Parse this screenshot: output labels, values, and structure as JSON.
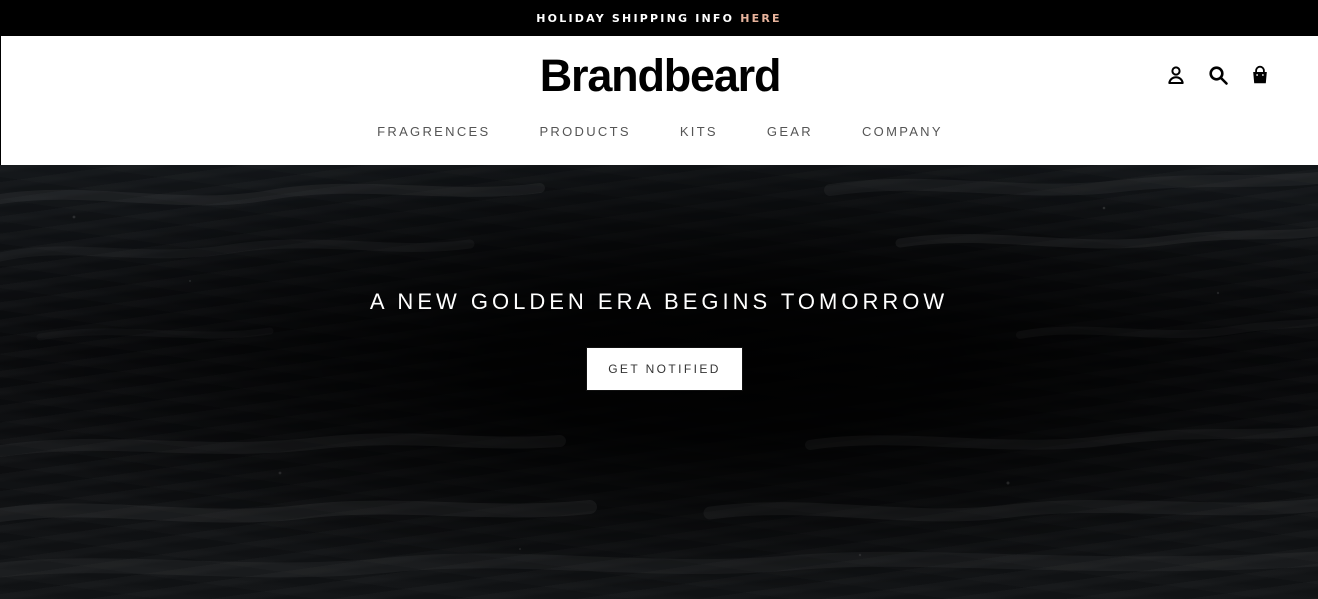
{
  "announcement": {
    "text": "HOLIDAY SHIPPING INFO",
    "link_label": "HERE",
    "link_color": "#e7b39c"
  },
  "header": {
    "logo": "Brandbeard",
    "nav": [
      {
        "label": "FRAGRENCES"
      },
      {
        "label": "PRODUCTS"
      },
      {
        "label": "KITS"
      },
      {
        "label": "GEAR"
      },
      {
        "label": "COMPANY"
      }
    ],
    "icons": [
      "account-icon",
      "search-icon",
      "cart-icon"
    ]
  },
  "hero": {
    "title": "A NEW GOLDEN ERA BEGINS TOMORROW",
    "button_label": "GET NOTIFIED"
  },
  "colors": {
    "announcement_bg": "#000000",
    "header_bg": "#ffffff",
    "hero_bg": "#0b0c0e",
    "text_light": "#ffffff"
  }
}
